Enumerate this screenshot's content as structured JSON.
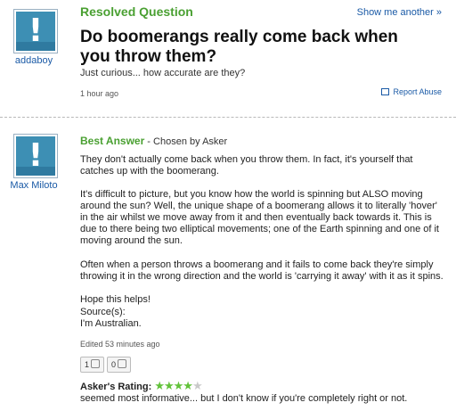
{
  "question": {
    "label": "Resolved Question",
    "show_me": "Show me another »",
    "title": "Do boomerangs really come back when you throw them?",
    "details": "Just curious... how accurate are they?",
    "time": "1 hour ago",
    "report": "Report Abuse",
    "asker": "addaboy"
  },
  "answer": {
    "label": "Best Answer",
    "chosen_by": " - Chosen by Asker",
    "answerer": "Max Miloto",
    "paragraphs": [
      "They don't actually come back when you throw them. In fact, it's yourself that catches up with the boomerang.",
      "It's difficult to picture, but you know how the world is spinning but ALSO moving around the sun? Well, the unique shape of a boomerang allows it to literally 'hover' in the air whilst we move away from it and then eventually back towards it. This is due to there being two elliptical movements; one of the Earth spinning and one of it moving around the sun.",
      "Often when a person throws a boomerang and it fails to come back they're simply throwing it in the wrong direction and the world is 'carrying it away' with it as it spins.",
      "Hope this helps!"
    ],
    "sources_label": "Source(s):",
    "source": "I'm Australian.",
    "edited": "Edited 53 minutes ago",
    "thumbs_up": "1",
    "thumbs_down": "0",
    "rating_label": "Asker's Rating:",
    "rating": {
      "stars": 4,
      "max": 5
    },
    "rating_comment": "seemed most informative... but I don't know if you're completely right or not."
  },
  "colors": {
    "green": "#4aa032",
    "link": "#1a5aa6",
    "star": "#62c23a",
    "avatar": "#3d8fb4"
  }
}
